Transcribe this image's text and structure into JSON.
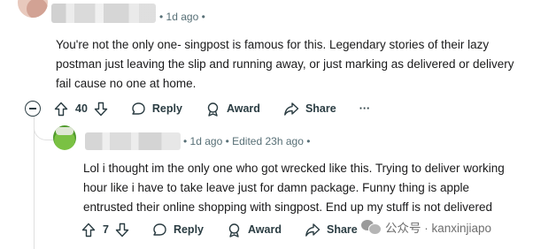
{
  "comment": {
    "time": "1d ago",
    "text_lines": [
      "You're not the only one- singpost is famous for this. Legendary stories of their lazy",
      "postman just leaving the slip and running away, or just marking as delivered or delivery",
      "fail cause no one at home."
    ],
    "actions": {
      "votes": "40",
      "reply": "Reply",
      "award": "Award",
      "share": "Share",
      "more": "···"
    }
  },
  "reply": {
    "time": "1d ago",
    "edited": "Edited 23h ago",
    "text_lines": [
      "Lol i thought im the only one who got wrecked like this. Trying to deliver working",
      "hour like i have to take leave just for damn package. Funny thing is apple",
      "entrusted their online shopping with singpost. End up my stuff is not delivered"
    ],
    "actions": {
      "votes": "7",
      "reply": "Reply",
      "award": "Award",
      "share": "Share"
    }
  },
  "watermark": {
    "text": "公众号 · kanxinjiapo"
  },
  "colors": {
    "text": "#1a1a1b",
    "meta": "#576f76",
    "icon": "#2a3c42"
  }
}
